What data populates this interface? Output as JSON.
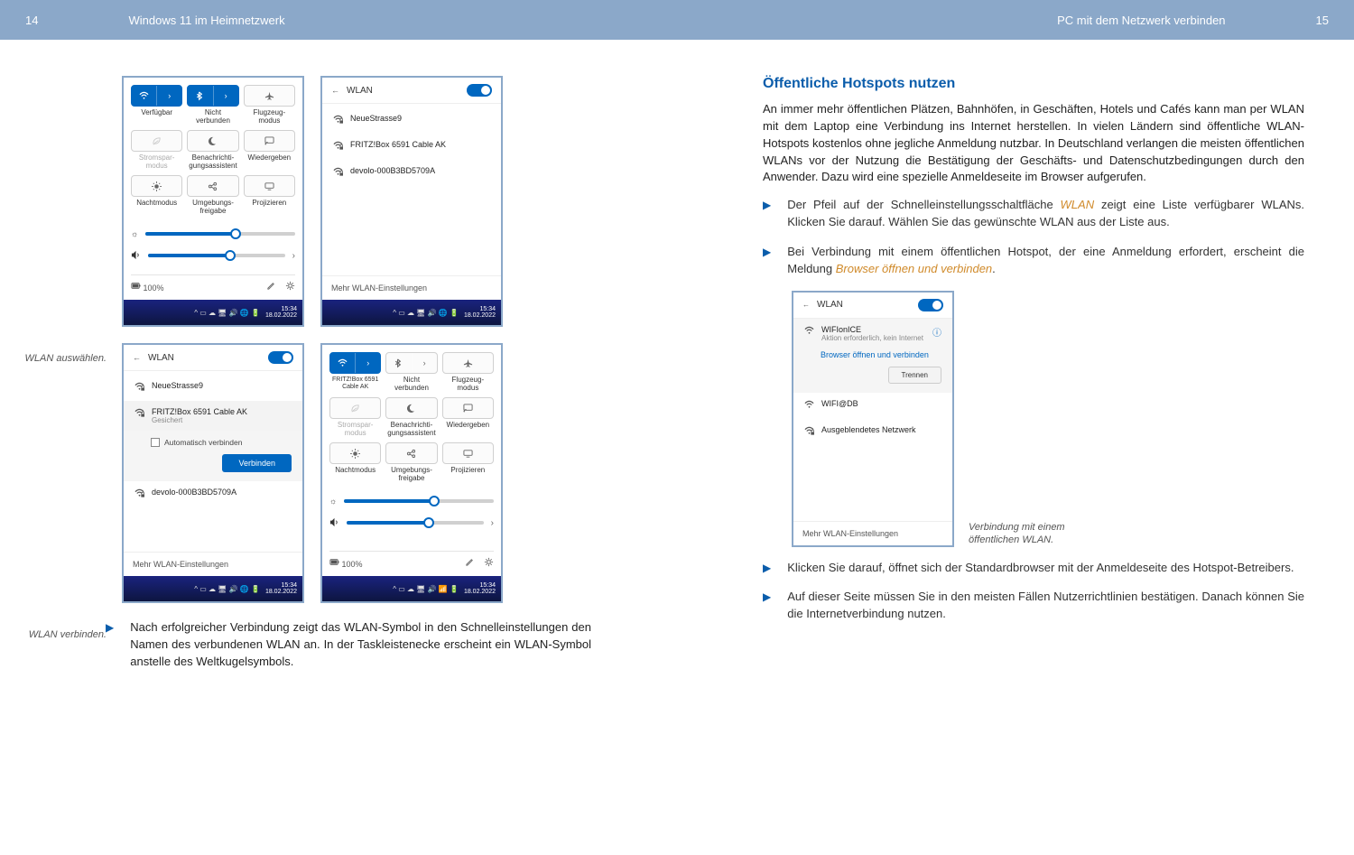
{
  "header": {
    "pageLeft": "14",
    "titleLeft": "Windows 11 im Heimnetzwerk",
    "titleRight": "PC mit dem Netzwerk verbinden",
    "pageRight": "15"
  },
  "captions": {
    "c1": "WLAN auswählen.",
    "c2": "WLAN verbinden.",
    "c3": "Verbindung mit einem öffentlichen WLAN."
  },
  "qs": {
    "labels": {
      "avail": "Verfügbar",
      "notconn": "Nicht verbunden",
      "flight": "Flugzeug-\nmodus",
      "save": "Stromspar-\nmodus",
      "notif": "Benachrichti-\ngungsassistent",
      "cast": "Wiedergeben",
      "night": "Nachtmodus",
      "share": "Umgebungs-\nfreigabe",
      "proj": "Projizieren"
    },
    "connectedName": "FRITZ!Box 6591 Cable AK",
    "battery": "100%",
    "time": "15:34",
    "date": "18.02.2022"
  },
  "wlan": {
    "title": "WLAN",
    "nets": [
      "NeueStrasse9",
      "FRITZ!Box 6591 Cable AK",
      "devolo-000B3BD5709A"
    ],
    "secured": "Gesichert",
    "auto": "Automatisch verbinden",
    "connect": "Verbinden",
    "more": "Mehr WLAN-Einstellungen"
  },
  "hotspot": {
    "net1": "WIFIonICE",
    "net1sub": "Aktion erforderlich, kein Internet",
    "openlink": "Browser öffnen und verbinden",
    "disconnect": "Trennen",
    "net2": "WIFI@DB",
    "net3": "Ausgeblendetes Netzwerk"
  },
  "leftBullet": {
    "text": "Nach erfolgreicher Verbindung zeigt das WLAN-Symbol in den Schnellein­stellungen den Namen des verbundenen WLAN an. In der Taskleistenecke erscheint ein WLAN-Symbol anstelle des Weltkugelsymbols."
  },
  "right": {
    "heading": "Öffentliche Hotspots nutzen",
    "para": "An immer mehr öffentlichen Plätzen, Bahnhöfen, in Geschäften, Hotels und Cafés kann man per WLAN mit dem Laptop eine Verbindung ins Internet herstellen. In vielen Ländern sind öffentliche WLAN-Hotspots kostenlos ohne jegliche Anmel­dung nutzbar. In Deutschland verlangen die meisten öffentlichen WLANs vor der Nutzung die Bestätigung der Geschäfts- und Datenschutzbedingungen durch den Anwender. Dazu wird eine spezielle Anmeldeseite im Browser aufgerufen.",
    "b1a": "Der Pfeil auf der Schnelleinstellungsschaltfläche ",
    "b1hl": "WLAN",
    "b1b": " zeigt eine Liste ver­fügbarer WLANs. Klicken Sie darauf. Wählen Sie das gewünschte WLAN aus der Liste aus.",
    "b2a": "Bei Verbindung mit einem öffentlichen Hotspot, der eine Anmeldung erfor­dert, erscheint die Meldung ",
    "b2hl": "Browser öffnen und verbinden",
    "b2b": ".",
    "b3": "Klicken Sie darauf, öffnet sich der Standardbrowser mit der Anmeldeseite des Hotspot-Betreibers.",
    "b4": "Auf dieser Seite müssen Sie in den meisten Fällen Nutzerrichtlinien bestäti­gen. Danach können Sie die Internetverbindung nutzen."
  }
}
